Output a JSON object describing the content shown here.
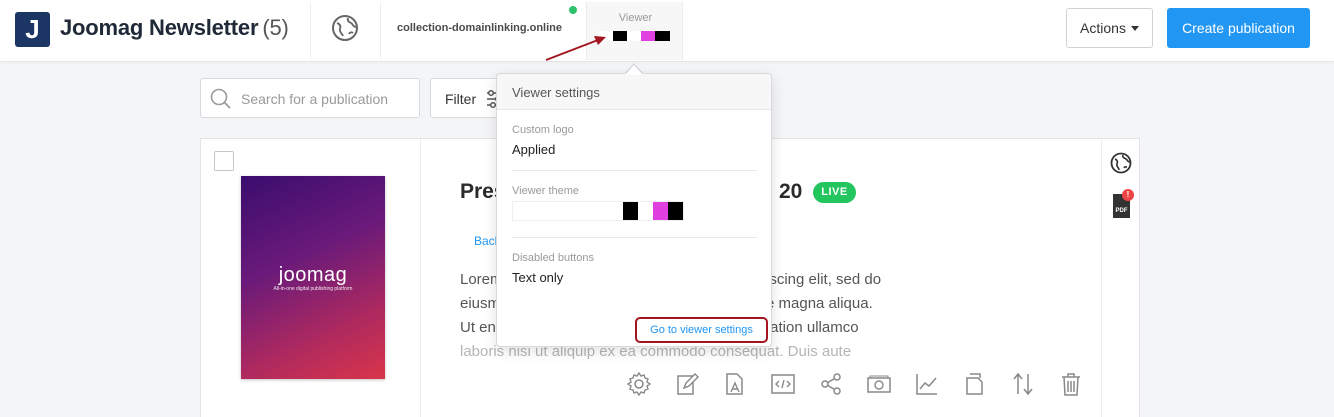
{
  "header": {
    "logo_letter": "J",
    "app_title": "Joomag Newsletter",
    "app_count": "(5)",
    "domain": "collection-domainlinking.online",
    "viewer_label": "Viewer",
    "actions_label": "Actions",
    "create_label": "Create publication"
  },
  "toolbar": {
    "search_placeholder": "Search for a publication",
    "filter_label": "Filter"
  },
  "publication": {
    "cover_brand": "joomag",
    "cover_tagline": "All-in-one digital publishing platform",
    "title_start": "Pres",
    "title_end": "20",
    "status_badge": "LIVE",
    "back_link": "Back",
    "description_left": [
      "Lorem",
      "eiusm",
      "Ut en",
      "laboris nisi ut aliquip ex ea commodo consequat. Duis aute"
    ],
    "description_right": [
      "iscing elit, sed do",
      "e magna aliqua.",
      "tation ullamco",
      ""
    ]
  },
  "viewer_settings": {
    "title": "Viewer settings",
    "custom_logo_label": "Custom logo",
    "custom_logo_value": "Applied",
    "theme_label": "Viewer theme",
    "disabled_buttons_label": "Disabled buttons",
    "disabled_buttons_value": "Text only",
    "go_link": "Go to viewer settings"
  },
  "theme_colors": [
    "#ffffff",
    "#000000",
    "#ffffff",
    "#e040e0",
    "#000000"
  ],
  "colors": {
    "primary": "#2196f3",
    "live": "#22c55e",
    "header_logo": "#1b3564",
    "annotation": "#a3161f"
  }
}
